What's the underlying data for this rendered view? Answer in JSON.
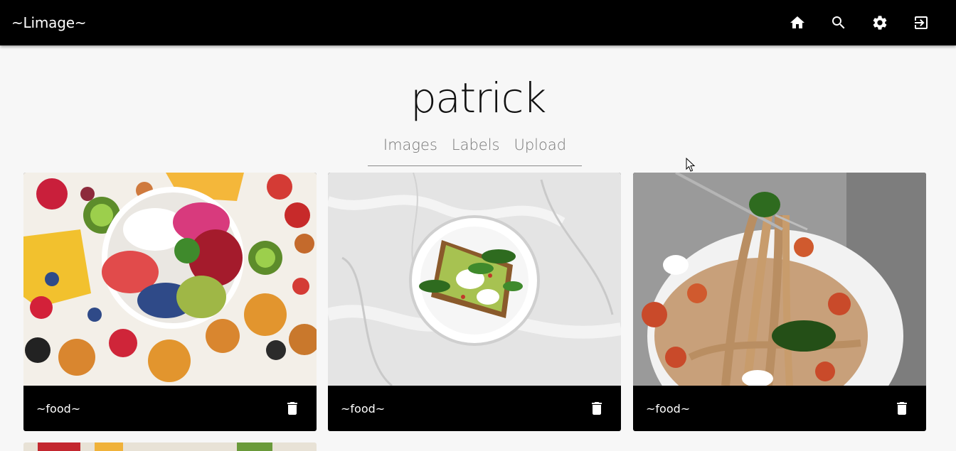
{
  "app": {
    "brand": "~Limage~",
    "nav_icons": [
      "home-icon",
      "search-icon",
      "settings-icon",
      "logout-icon"
    ]
  },
  "profile": {
    "name": "patrick",
    "tabs": [
      "Images",
      "Labels",
      "Upload"
    ]
  },
  "gallery": {
    "cards": [
      {
        "label": "~food~",
        "image": "fruit-bowl-photo"
      },
      {
        "label": "~food~",
        "image": "avocado-toast-photo"
      },
      {
        "label": "~food~",
        "image": "spaghetti-photo"
      }
    ]
  },
  "colors": {
    "topbar": "#000000",
    "background": "#f7f7f7",
    "card": "#000000"
  }
}
